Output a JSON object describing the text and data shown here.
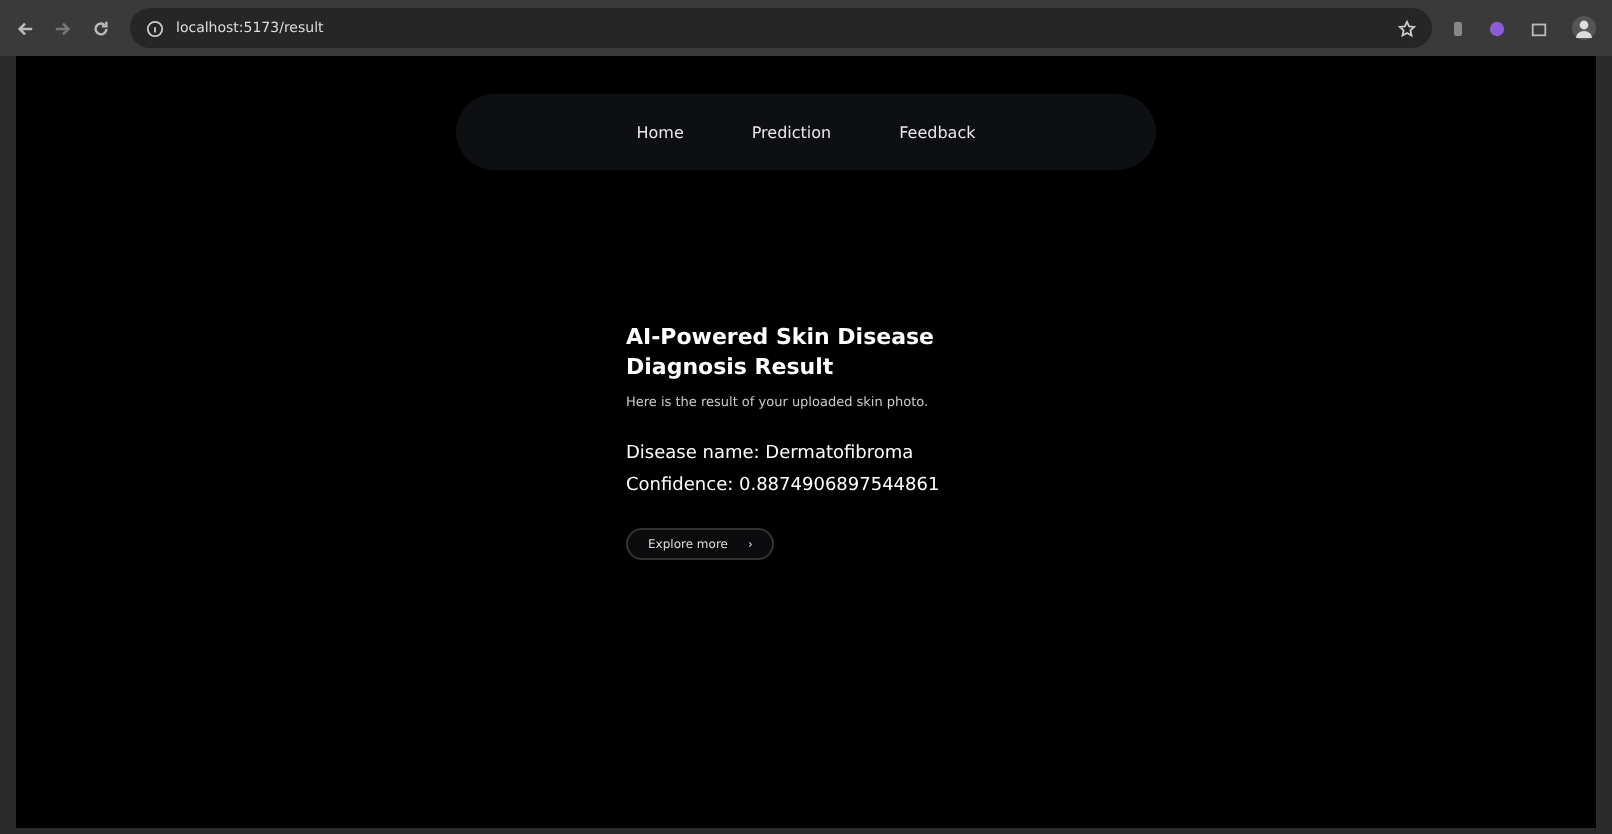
{
  "browser": {
    "url": "localhost:5173/result"
  },
  "nav": [
    {
      "label": "Home"
    },
    {
      "label": "Prediction"
    },
    {
      "label": "Feedback"
    }
  ],
  "result": {
    "title": "AI-Powered Skin Disease Diagnosis Result",
    "subtitle": "Here is the result of your uploaded skin photo.",
    "disease": "Disease name: Dermatofibroma",
    "confidence": "Confidence: 0.8874906897544861",
    "button": "Explore more",
    "button_icon": "›"
  }
}
